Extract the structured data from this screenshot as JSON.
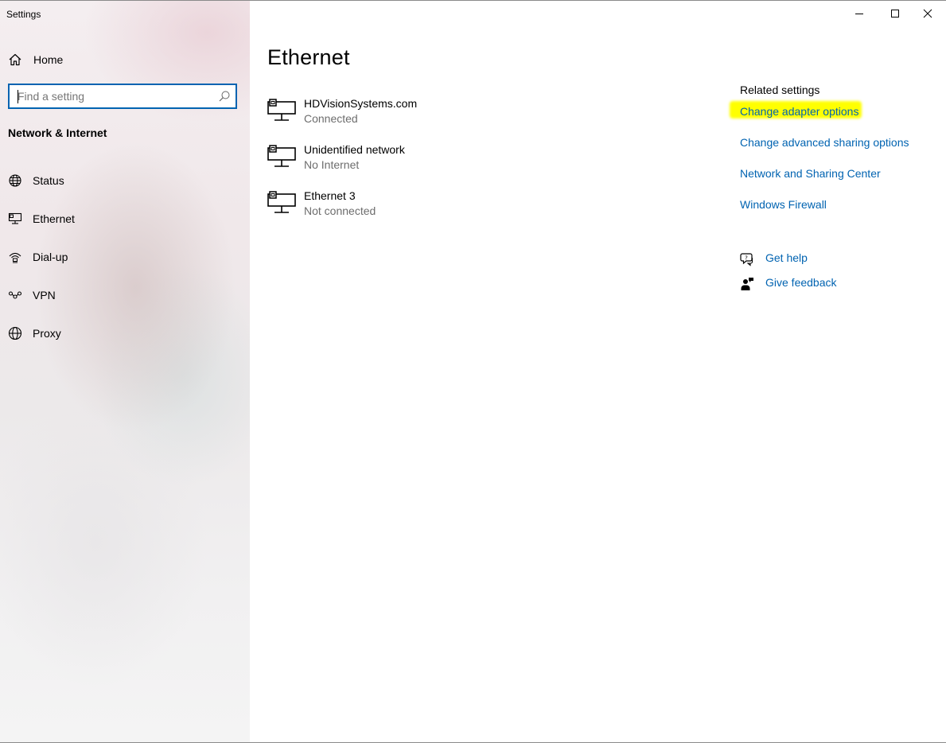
{
  "window": {
    "app_title": "Settings"
  },
  "sidebar": {
    "home_label": "Home",
    "search_placeholder": "Find a setting",
    "section_title": "Network & Internet",
    "items": [
      {
        "label": "Status",
        "icon": "globe-icon"
      },
      {
        "label": "Ethernet",
        "icon": "ethernet-icon"
      },
      {
        "label": "Dial-up",
        "icon": "dialup-icon"
      },
      {
        "label": "VPN",
        "icon": "vpn-icon"
      },
      {
        "label": "Proxy",
        "icon": "proxy-globe-icon"
      }
    ]
  },
  "main": {
    "title": "Ethernet",
    "networks": [
      {
        "name": "HDVisionSystems.com",
        "status": "Connected"
      },
      {
        "name": "Unidentified network",
        "status": "No Internet"
      },
      {
        "name": "Ethernet 3",
        "status": "Not connected"
      }
    ]
  },
  "related": {
    "title": "Related settings",
    "links": [
      "Change adapter options",
      "Change advanced sharing options",
      "Network and Sharing Center",
      "Windows Firewall"
    ],
    "get_help": "Get help",
    "give_feedback": "Give feedback"
  },
  "colors": {
    "accent": "#0063b1",
    "highlight": "#ffff00",
    "secondary_text": "#6d6d6d"
  }
}
